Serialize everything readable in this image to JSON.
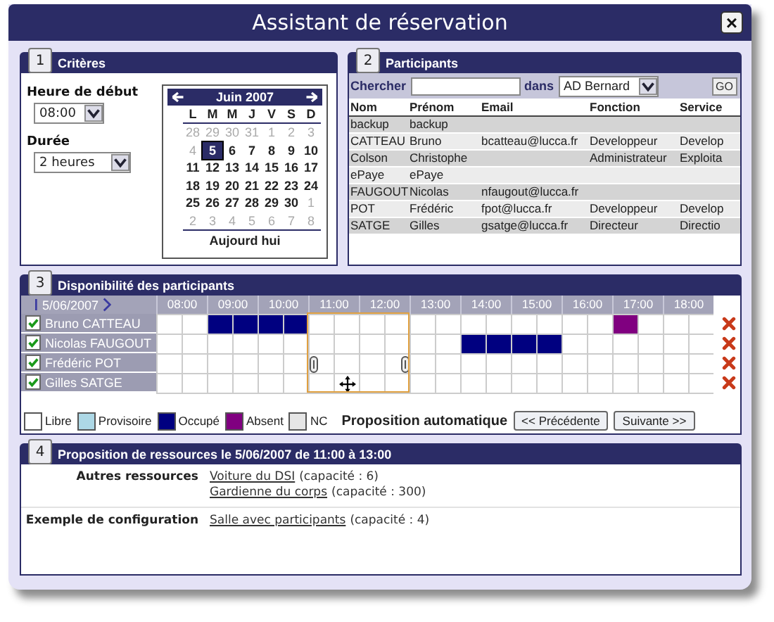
{
  "window": {
    "title": "Assistant de réservation",
    "close": "×"
  },
  "criteria": {
    "number": "1",
    "title": "Critères",
    "start_label": "Heure de début",
    "start_value": "08:00",
    "duration_label": "Durée",
    "duration_value": "2 heures",
    "calendar": {
      "month": "Juin 2007",
      "weekdays": [
        "L",
        "M",
        "M",
        "J",
        "V",
        "S",
        "D"
      ],
      "today_link": "Aujourd hui",
      "weeks": [
        {
          "days": [
            {
              "label": "28",
              "kind": "muted",
              "selected": false
            },
            {
              "label": "29",
              "kind": "muted",
              "selected": false
            },
            {
              "label": "30",
              "kind": "muted",
              "selected": false
            },
            {
              "label": "31",
              "kind": "muted",
              "selected": false
            },
            {
              "label": "1",
              "kind": "muted",
              "selected": false
            },
            {
              "label": "2",
              "kind": "muted",
              "selected": false
            },
            {
              "label": "3",
              "kind": "muted",
              "selected": false
            }
          ]
        },
        {
          "days": [
            {
              "label": "4",
              "kind": "muted",
              "selected": false
            },
            {
              "label": "5",
              "kind": "day",
              "selected": true
            },
            {
              "label": "6",
              "kind": "day",
              "selected": false
            },
            {
              "label": "7",
              "kind": "day",
              "selected": false
            },
            {
              "label": "8",
              "kind": "day",
              "selected": false
            },
            {
              "label": "9",
              "kind": "day",
              "selected": false
            },
            {
              "label": "10",
              "kind": "day",
              "selected": false
            }
          ]
        },
        {
          "days": [
            {
              "label": "11",
              "kind": "day",
              "selected": false
            },
            {
              "label": "12",
              "kind": "day",
              "selected": false
            },
            {
              "label": "13",
              "kind": "day",
              "selected": false
            },
            {
              "label": "14",
              "kind": "day",
              "selected": false
            },
            {
              "label": "15",
              "kind": "day",
              "selected": false
            },
            {
              "label": "16",
              "kind": "day",
              "selected": false
            },
            {
              "label": "17",
              "kind": "day",
              "selected": false
            }
          ]
        },
        {
          "days": [
            {
              "label": "18",
              "kind": "day",
              "selected": false
            },
            {
              "label": "19",
              "kind": "day",
              "selected": false
            },
            {
              "label": "20",
              "kind": "day",
              "selected": false
            },
            {
              "label": "21",
              "kind": "day",
              "selected": false
            },
            {
              "label": "22",
              "kind": "day",
              "selected": false
            },
            {
              "label": "23",
              "kind": "day",
              "selected": false
            },
            {
              "label": "24",
              "kind": "day",
              "selected": false
            }
          ]
        },
        {
          "days": [
            {
              "label": "25",
              "kind": "day",
              "selected": false
            },
            {
              "label": "26",
              "kind": "day",
              "selected": false
            },
            {
              "label": "27",
              "kind": "day",
              "selected": false
            },
            {
              "label": "28",
              "kind": "day",
              "selected": false
            },
            {
              "label": "29",
              "kind": "day",
              "selected": false
            },
            {
              "label": "30",
              "kind": "day",
              "selected": false
            },
            {
              "label": "1",
              "kind": "muted",
              "selected": false
            }
          ]
        },
        {
          "days": [
            {
              "label": "2",
              "kind": "muted",
              "selected": false
            },
            {
              "label": "3",
              "kind": "muted",
              "selected": false
            },
            {
              "label": "4",
              "kind": "muted",
              "selected": false
            },
            {
              "label": "5",
              "kind": "muted",
              "selected": false
            },
            {
              "label": "6",
              "kind": "muted",
              "selected": false
            },
            {
              "label": "7",
              "kind": "muted",
              "selected": false
            },
            {
              "label": "8",
              "kind": "muted",
              "selected": false
            }
          ]
        }
      ]
    }
  },
  "participants": {
    "number": "2",
    "title": "Participants",
    "search_label": "Chercher",
    "in_label": "dans",
    "directory": "AD Bernard",
    "go": "GO",
    "columns": [
      "Nom",
      "Prénom",
      "Email",
      "Fonction",
      "Service"
    ],
    "rows": [
      [
        "backup",
        "backup",
        "",
        "",
        ""
      ],
      [
        "CATTEAU",
        "Bruno",
        "bcatteau@lucca.fr",
        "Developpeur",
        "Develop"
      ],
      [
        "Colson",
        "Christophe",
        "",
        "Administrateur",
        "Exploita"
      ],
      [
        "ePaye",
        "ePaye",
        "",
        "",
        ""
      ],
      [
        "FAUGOUT",
        "Nicolas",
        "nfaugout@lucca.fr",
        "",
        ""
      ],
      [
        "POT",
        "Frédéric",
        "fpot@lucca.fr",
        "Developpeur",
        "Develop"
      ],
      [
        "SATGE",
        "Gilles",
        "gsatge@lucca.fr",
        "Directeur",
        "Directio"
      ]
    ]
  },
  "schedule": {
    "number": "3",
    "title": "Disponibilité des participants",
    "date": "5/06/2007",
    "hours": [
      {
        "label": "08:00",
        "selected": false
      },
      {
        "label": "09:00",
        "selected": false
      },
      {
        "label": "10:00",
        "selected": false
      },
      {
        "label": "11:00",
        "selected": true
      },
      {
        "label": "12:00",
        "selected": true
      },
      {
        "label": "13:00",
        "selected": false
      },
      {
        "label": "14:00",
        "selected": false
      },
      {
        "label": "15:00",
        "selected": false
      },
      {
        "label": "16:00",
        "selected": false
      },
      {
        "label": "17:00",
        "selected": false
      },
      {
        "label": "18:00",
        "selected": false
      }
    ],
    "rows": [
      {
        "name": "Bruno CATTEAU",
        "checked": true,
        "slots": [
          {
            "kind": "free"
          },
          {
            "kind": "free"
          },
          {
            "kind": "busy"
          },
          {
            "kind": "busy"
          },
          {
            "kind": "busy"
          },
          {
            "kind": "busy"
          },
          {
            "kind": "free"
          },
          {
            "kind": "free"
          },
          {
            "kind": "free"
          },
          {
            "kind": "free"
          },
          {
            "kind": "free"
          },
          {
            "kind": "free"
          },
          {
            "kind": "free"
          },
          {
            "kind": "free"
          },
          {
            "kind": "free"
          },
          {
            "kind": "free"
          },
          {
            "kind": "free"
          },
          {
            "kind": "free"
          },
          {
            "kind": "absent"
          },
          {
            "kind": "free"
          },
          {
            "kind": "free"
          },
          {
            "kind": "free"
          }
        ]
      },
      {
        "name": "Nicolas FAUGOUT",
        "checked": true,
        "slots": [
          {
            "kind": "free"
          },
          {
            "kind": "free"
          },
          {
            "kind": "free"
          },
          {
            "kind": "free"
          },
          {
            "kind": "free"
          },
          {
            "kind": "free"
          },
          {
            "kind": "free"
          },
          {
            "kind": "free"
          },
          {
            "kind": "free"
          },
          {
            "kind": "free"
          },
          {
            "kind": "free"
          },
          {
            "kind": "free"
          },
          {
            "kind": "busy"
          },
          {
            "kind": "busy"
          },
          {
            "kind": "busy"
          },
          {
            "kind": "busy"
          },
          {
            "kind": "free"
          },
          {
            "kind": "free"
          },
          {
            "kind": "free"
          },
          {
            "kind": "free"
          },
          {
            "kind": "free"
          },
          {
            "kind": "free"
          }
        ]
      },
      {
        "name": "Frédéric POT",
        "checked": true,
        "slots": [
          {
            "kind": "free"
          },
          {
            "kind": "free"
          },
          {
            "kind": "free"
          },
          {
            "kind": "free"
          },
          {
            "kind": "free"
          },
          {
            "kind": "free"
          },
          {
            "kind": "free"
          },
          {
            "kind": "free"
          },
          {
            "kind": "free"
          },
          {
            "kind": "free"
          },
          {
            "kind": "free"
          },
          {
            "kind": "free"
          },
          {
            "kind": "free"
          },
          {
            "kind": "free"
          },
          {
            "kind": "free"
          },
          {
            "kind": "free"
          },
          {
            "kind": "free"
          },
          {
            "kind": "free"
          },
          {
            "kind": "free"
          },
          {
            "kind": "free"
          },
          {
            "kind": "free"
          },
          {
            "kind": "free"
          }
        ]
      },
      {
        "name": "Gilles SATGE",
        "checked": true,
        "slots": [
          {
            "kind": "free"
          },
          {
            "kind": "free"
          },
          {
            "kind": "free"
          },
          {
            "kind": "free"
          },
          {
            "kind": "free"
          },
          {
            "kind": "free"
          },
          {
            "kind": "free"
          },
          {
            "kind": "free"
          },
          {
            "kind": "free"
          },
          {
            "kind": "free"
          },
          {
            "kind": "free"
          },
          {
            "kind": "free"
          },
          {
            "kind": "free"
          },
          {
            "kind": "free"
          },
          {
            "kind": "free"
          },
          {
            "kind": "free"
          },
          {
            "kind": "free"
          },
          {
            "kind": "free"
          },
          {
            "kind": "free"
          },
          {
            "kind": "free"
          },
          {
            "kind": "free"
          },
          {
            "kind": "free"
          }
        ]
      }
    ],
    "legend": [
      {
        "label": "Libre",
        "kind": "free"
      },
      {
        "label": "Provisoire",
        "kind": "provisional"
      },
      {
        "label": "Occupé",
        "kind": "busy"
      },
      {
        "label": "Absent",
        "kind": "absent"
      },
      {
        "label": "NC",
        "kind": "nc"
      }
    ],
    "auto_label": "Proposition automatique",
    "prev_button": "<< Précédente",
    "next_button": "Suivante >>"
  },
  "resources": {
    "number": "4",
    "title": "Proposition de ressources le 5/06/2007 de 11:00 à 13:00",
    "groups": [
      {
        "label": "Autres ressources",
        "items": [
          {
            "link": "Voiture du DSI",
            "note": "(capacité : 6)"
          },
          {
            "link": "Gardienne du corps",
            "note": "(capacité : 300)"
          }
        ]
      },
      {
        "label": "Exemple de configuration",
        "items": [
          {
            "link": "Salle avec participants",
            "note": "(capacité : 4)"
          }
        ]
      }
    ]
  }
}
